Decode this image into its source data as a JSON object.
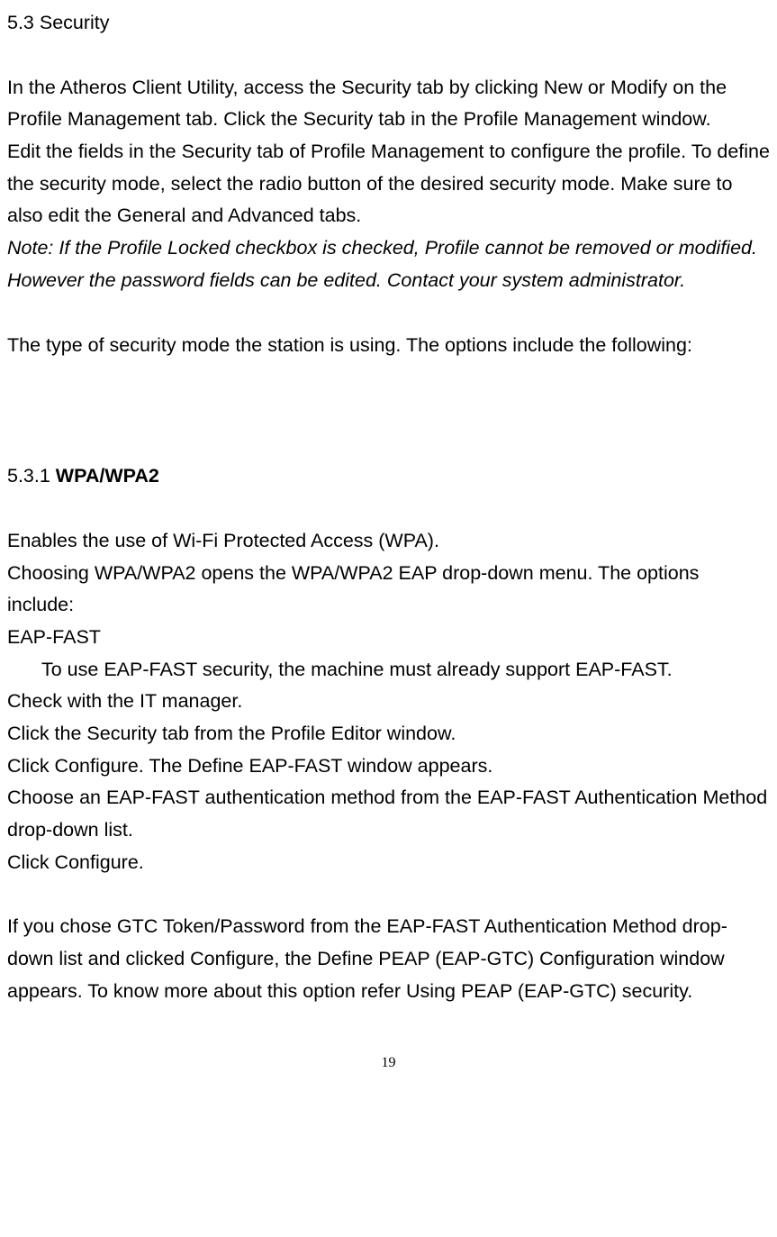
{
  "heading_53": "5.3 Security",
  "para1": "In the Atheros Client Utility, access the Security tab by clicking New or Modify on the Profile Management tab.   Click the Security tab in the Profile Management window.",
  "para2": "Edit the fields in the Security   tab of Profile Management   to configure the profile. To define the security mode, select the radio button of the desired security mode. Make sure to also edit the General and Advanced tabs.",
  "note": "Note: If the Profile Locked checkbox is checked, Profile cannot be removed or modified. However the password fields can be edited. Contact your system administrator.",
  "para3": "The type of security mode the station is using. The options include the following:",
  "heading_531_prefix": "5.3.1 ",
  "heading_531_bold": "WPA/WPA2",
  "wpa_para1": "Enables the use of Wi-Fi Protected Access (WPA).",
  "wpa_para2": "Choosing WPA/WPA2 opens the WPA/WPA2 EAP drop-down menu. The options include:",
  "wpa_eapfast": "EAP-FAST",
  "wpa_eapfast_line1": "To use EAP-FAST security, the machine must already support EAP-FAST.",
  "wpa_eapfast_line2": "Check with the IT manager.",
  "wpa_step1": "Click the Security tab from the Profile Editor window.",
  "wpa_step2": "Click Configure. The Define EAP-FAST window appears.",
  "wpa_step3": "Choose an EAP-FAST authentication method from the EAP-FAST Authentication Method drop-down list.",
  "wpa_step4": "Click Configure.",
  "gtc_para": "If you chose GTC Token/Password from the EAP-FAST Authentication Method drop-down list and clicked Configure, the Define PEAP (EAP-GTC) Configuration window appears. To know more about this option refer Using PEAP (EAP-GTC) security.",
  "page_number": "19"
}
